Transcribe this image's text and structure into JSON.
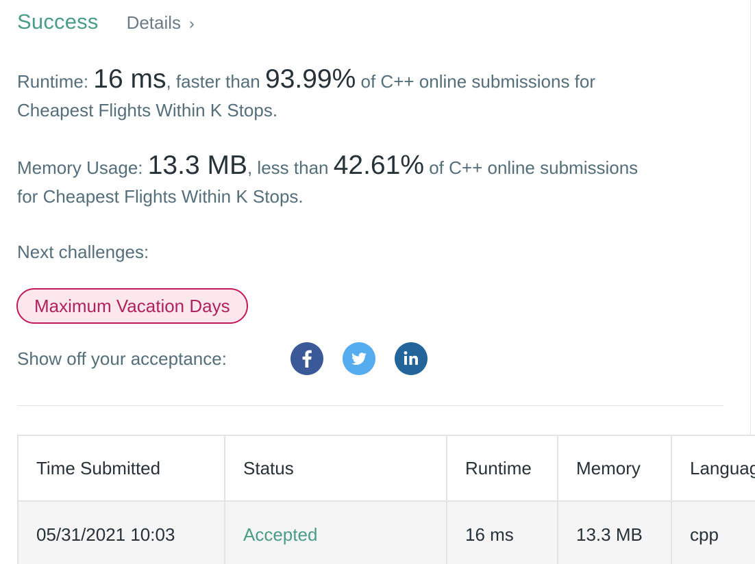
{
  "header": {
    "status": "Success",
    "details_label": "Details",
    "chevron": "›"
  },
  "runtime": {
    "label": "Runtime: ",
    "value": "16 ms",
    "comparison": ", faster than ",
    "percentile": "93.99%",
    "suffix": " of C++ online submissions for",
    "problem_line": "Cheapest Flights Within K Stops."
  },
  "memory": {
    "label": "Memory Usage: ",
    "value": "13.3 MB",
    "comparison": ", less than ",
    "percentile": "42.61%",
    "suffix": " of C++ online submissions",
    "problem_line": "for Cheapest Flights Within K Stops."
  },
  "next_challenges": {
    "label": "Next challenges:",
    "items": [
      "Maximum Vacation Days"
    ]
  },
  "share": {
    "label": "Show off your acceptance:",
    "icons": [
      {
        "name": "facebook-icon",
        "color": "#3b5998"
      },
      {
        "name": "twitter-icon",
        "color": "#55acee"
      },
      {
        "name": "linkedin-icon",
        "color": "#23649b"
      }
    ]
  },
  "submissions": {
    "columns": [
      "Time Submitted",
      "Status",
      "Runtime",
      "Memory",
      "Language"
    ],
    "rows": [
      [
        "05/31/2021 10:03",
        "Accepted",
        "16 ms",
        "13.3 MB",
        "cpp"
      ]
    ]
  },
  "colors": {
    "success": "#4a9d85",
    "tag_border": "#c2185b",
    "tag_background": "#fbe7ec"
  }
}
